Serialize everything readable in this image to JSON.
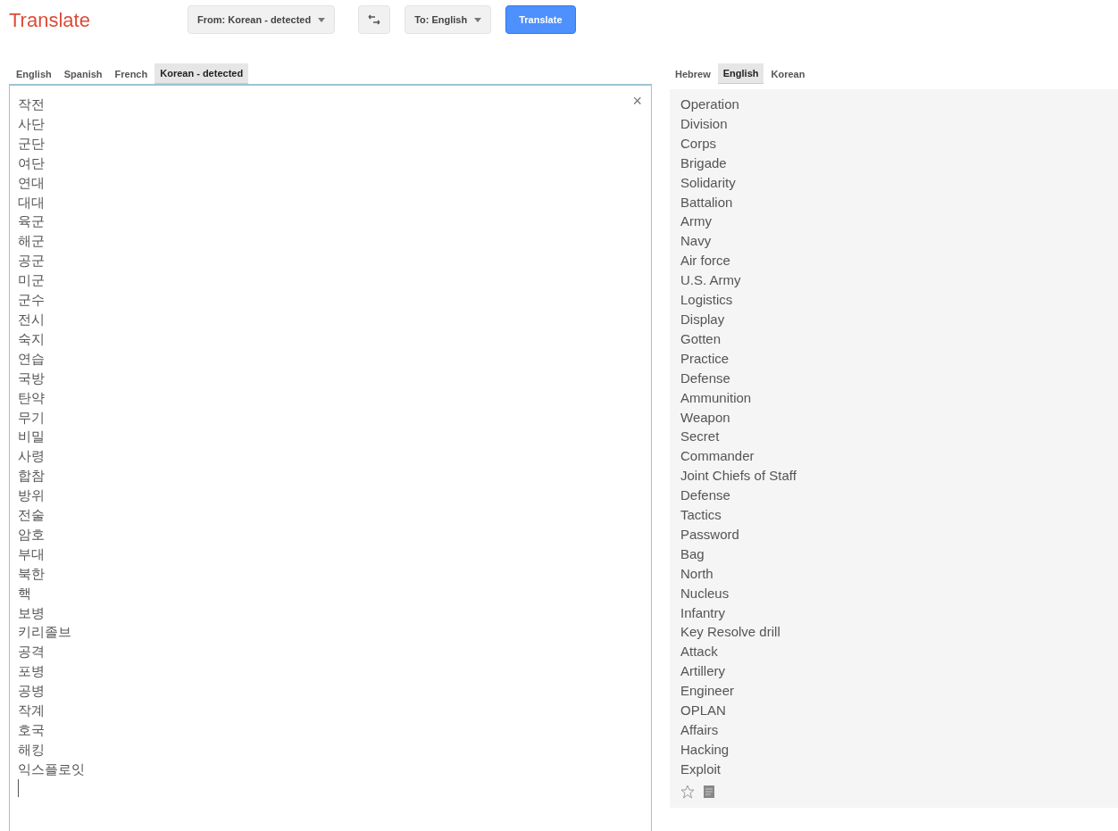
{
  "header": {
    "title": "Translate",
    "from_button": "From: Korean - detected",
    "to_button": "To: English",
    "translate_button": "Translate"
  },
  "source_tabs": [
    {
      "label": "English",
      "selected": false
    },
    {
      "label": "Spanish",
      "selected": false
    },
    {
      "label": "French",
      "selected": false
    },
    {
      "label": "Korean - detected",
      "selected": true
    }
  ],
  "target_tabs": [
    {
      "label": "Hebrew",
      "selected": false
    },
    {
      "label": "English",
      "selected": true
    },
    {
      "label": "Korean",
      "selected": false
    }
  ],
  "source_lines": [
    "작전",
    "사단",
    "군단",
    "여단",
    "연대",
    "대대",
    "육군",
    "해군",
    "공군",
    "미군",
    "군수",
    "전시",
    "숙지",
    "연습",
    "국방",
    "탄약",
    "무기",
    "비밀",
    "사령",
    "합참",
    "방위",
    "전술",
    "암호",
    "부대",
    "북한",
    "핵",
    "보병",
    "키리졸브",
    "공격",
    "포병",
    "공병",
    "작계",
    "호국",
    "해킹",
    "익스플로잇"
  ],
  "clear_button": "×",
  "result_lines": [
    "Operation",
    "Division",
    "Corps",
    "Brigade",
    "Solidarity",
    "Battalion",
    "Army",
    "Navy",
    "Air force",
    "U.S. Army",
    "Logistics",
    "Display",
    "Gotten",
    "Practice",
    "Defense",
    "Ammunition",
    "Weapon",
    "Secret",
    "Commander",
    "Joint Chiefs of Staff",
    "Defense",
    "Tactics",
    "Password",
    "Bag",
    "North",
    "Nucleus",
    "Infantry",
    "Key Resolve drill",
    "Attack",
    "Artillery",
    "Engineer",
    "OPLAN",
    "Affairs",
    "Hacking",
    "Exploit"
  ]
}
